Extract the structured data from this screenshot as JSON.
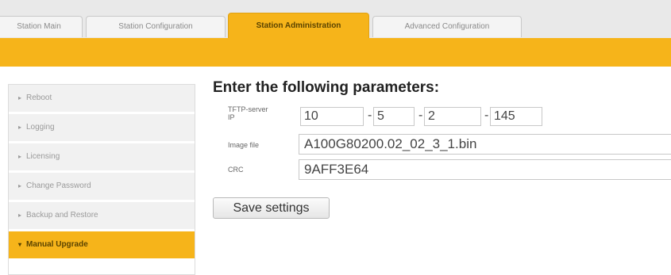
{
  "tabs": [
    {
      "label": "Station Main",
      "active": false
    },
    {
      "label": "Station Configuration",
      "active": false
    },
    {
      "label": "Station Administration",
      "active": true
    },
    {
      "label": "Advanced Configuration",
      "active": false
    }
  ],
  "sidebar": {
    "items": [
      {
        "label": "Reboot",
        "bullet": "▸",
        "active": false
      },
      {
        "label": "Logging",
        "bullet": "▸",
        "active": false
      },
      {
        "label": "Licensing",
        "bullet": "▸",
        "active": false
      },
      {
        "label": "Change Password",
        "bullet": "▸",
        "active": false
      },
      {
        "label": "Backup and Restore",
        "bullet": "▸",
        "active": false
      },
      {
        "label": "Manual Upgrade",
        "bullet": "▾",
        "active": true
      }
    ]
  },
  "form": {
    "heading": "Enter the following parameters:",
    "tftp_label_line1": "TFTP-server",
    "tftp_label_line2": "IP",
    "ip": {
      "o1": "10",
      "o2": "5",
      "o3": "2",
      "o4": "145",
      "separator": "-"
    },
    "image_file_label": "Image file",
    "image_file_value": "A100G80200.02_02_3_1.bin",
    "crc_label": "CRC",
    "crc_value": "9AFF3E64",
    "save_label": "Save settings"
  },
  "colors": {
    "accent": "#f6b41a",
    "tab_background": "#e9e9e9",
    "sidebar_item": "#f1f1f1"
  }
}
